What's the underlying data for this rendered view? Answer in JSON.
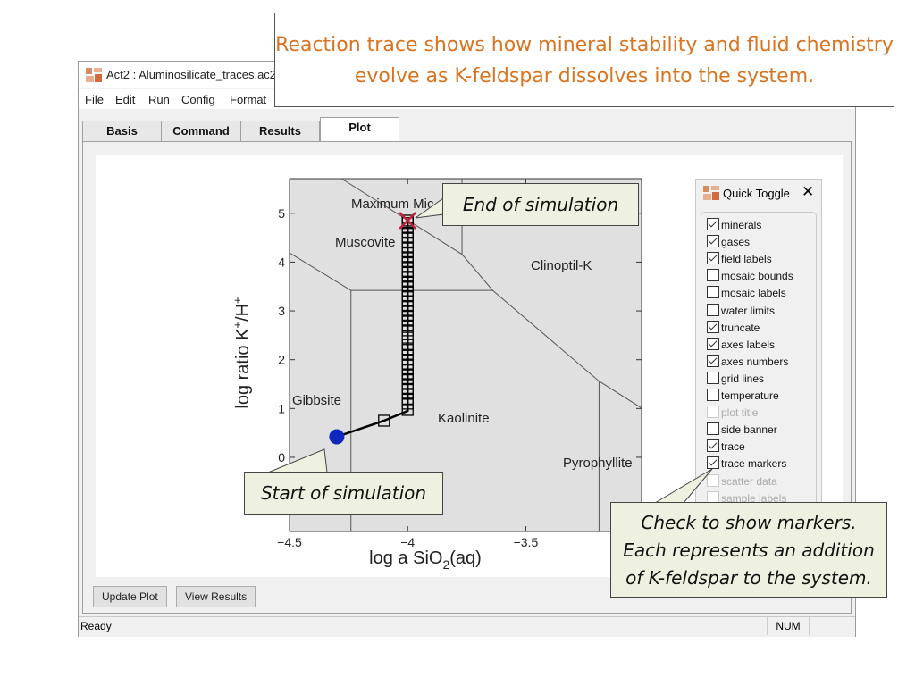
{
  "window": {
    "title": "Act2 : Aluminosilicate_traces.ac2"
  },
  "menu": [
    "File",
    "Edit",
    "Run",
    "Config",
    "Format"
  ],
  "tabs": [
    {
      "label": "Basis"
    },
    {
      "label": "Command"
    },
    {
      "label": "Results"
    },
    {
      "label": "Plot",
      "active": true
    }
  ],
  "buttons": {
    "update_plot": "Update Plot",
    "view_results": "View Results"
  },
  "status": {
    "text": "Ready",
    "num": "NUM"
  },
  "quick_toggle": {
    "title": "Quick Toggle",
    "close_icon": "close-icon",
    "items": [
      {
        "label": "minerals",
        "checked": true
      },
      {
        "label": "gases",
        "checked": true
      },
      {
        "label": "field labels",
        "checked": true
      },
      {
        "label": "mosaic bounds",
        "checked": false
      },
      {
        "label": "mosaic labels",
        "checked": false
      },
      {
        "label": "water limits",
        "checked": false
      },
      {
        "label": "truncate",
        "checked": true
      },
      {
        "label": "axes labels",
        "checked": true
      },
      {
        "label": "axes numbers",
        "checked": true
      },
      {
        "label": "grid lines",
        "checked": false
      },
      {
        "label": "temperature",
        "checked": false
      },
      {
        "label": "plot title",
        "checked": false,
        "disabled": true
      },
      {
        "label": "side banner",
        "checked": false
      },
      {
        "label": "trace",
        "checked": true
      },
      {
        "label": "trace markers",
        "checked": true
      },
      {
        "label": "scatter data",
        "checked": false,
        "disabled": true
      },
      {
        "label": "sample labels",
        "checked": false,
        "disabled": true
      }
    ]
  },
  "annotations": {
    "headline": "Reaction trace shows how mineral stability and fluid chemistry evolve as K-feldspar dissolves into the system.",
    "end": "End of simulation",
    "start": "Start of simulation",
    "markers_line1": "Check to show markers.",
    "markers_line2": "Each represents an addition",
    "markers_line3": "of K-feldspar to the system."
  },
  "chart_data": {
    "type": "line",
    "xlabel": "log a SiO2(aq)",
    "ylabel": "log ratio K+/H+",
    "xlim": [
      -4.5,
      -3.01
    ],
    "ylim": [
      -1.52,
      5.71
    ],
    "xticks": [
      -4.5,
      -4,
      -3.5
    ],
    "xtick_labels": [
      "−4.5",
      "−4",
      "−3.5"
    ],
    "yticks": [
      0,
      1,
      2,
      3,
      4,
      5
    ],
    "ytick_labels": [
      "0",
      "1",
      "2",
      "3",
      "4",
      "5"
    ],
    "grid": false,
    "colors": {
      "field": "#e0e0e0",
      "boundary": "#555555",
      "trace": "#000000",
      "start": "#1028c0",
      "end": "#c0203a"
    },
    "field_labels": [
      "Maximum Mic",
      "Muscovite",
      "Clinoptil-K",
      "Gibbsite",
      "Kaolinite",
      "Pyrophyllite"
    ],
    "boundaries": [
      [
        [
          -4.28,
          5.71
        ],
        [
          -3.77,
          4.16
        ],
        [
          -3.64,
          3.42
        ],
        [
          -3.19,
          1.56
        ],
        [
          -3.01,
          1.01
        ]
      ],
      [
        [
          -3.77,
          5.71
        ],
        [
          -3.77,
          4.16
        ]
      ],
      [
        [
          -4.5,
          4.19
        ],
        [
          -4.24,
          3.42
        ],
        [
          -3.64,
          3.42
        ]
      ],
      [
        [
          -4.24,
          3.42
        ],
        [
          -4.24,
          -1.52
        ]
      ],
      [
        [
          -3.19,
          1.56
        ],
        [
          -3.19,
          -1.52
        ]
      ]
    ],
    "trace": [
      [
        -4.3,
        0.42
      ],
      [
        -4.1,
        0.75
      ],
      [
        -4.0,
        0.95
      ],
      [
        -4.0,
        4.85
      ]
    ],
    "start_point": [
      -4.3,
      0.42
    ],
    "end_point": [
      -4.0,
      4.85
    ],
    "markers": [
      [
        -4.1,
        0.75
      ],
      [
        -4.0,
        0.97
      ],
      [
        -4.0,
        1.1
      ],
      [
        -4.0,
        1.2
      ],
      [
        -4.0,
        1.3
      ],
      [
        -4.0,
        1.4
      ],
      [
        -4.0,
        1.5
      ],
      [
        -4.0,
        1.6
      ],
      [
        -4.0,
        1.7
      ],
      [
        -4.0,
        1.8
      ],
      [
        -4.0,
        1.9
      ],
      [
        -4.0,
        2.0
      ],
      [
        -4.0,
        2.1
      ],
      [
        -4.0,
        2.2
      ],
      [
        -4.0,
        2.3
      ],
      [
        -4.0,
        2.45
      ],
      [
        -4.0,
        2.6
      ],
      [
        -4.0,
        2.7
      ],
      [
        -4.0,
        2.8
      ],
      [
        -4.0,
        2.9
      ],
      [
        -4.0,
        3.0
      ],
      [
        -4.0,
        3.1
      ],
      [
        -4.0,
        3.2
      ],
      [
        -4.0,
        3.3
      ],
      [
        -4.0,
        3.4
      ],
      [
        -4.0,
        3.5
      ],
      [
        -4.0,
        3.6
      ],
      [
        -4.0,
        3.7
      ],
      [
        -4.0,
        3.8
      ],
      [
        -4.0,
        3.9
      ],
      [
        -4.0,
        4.0
      ],
      [
        -4.0,
        4.1
      ],
      [
        -4.0,
        4.2
      ],
      [
        -4.0,
        4.3
      ],
      [
        -4.0,
        4.4
      ],
      [
        -4.0,
        4.5
      ],
      [
        -4.0,
        4.6
      ],
      [
        -4.0,
        4.7
      ],
      [
        -4.0,
        4.8
      ],
      [
        -4.0,
        4.85
      ]
    ]
  }
}
